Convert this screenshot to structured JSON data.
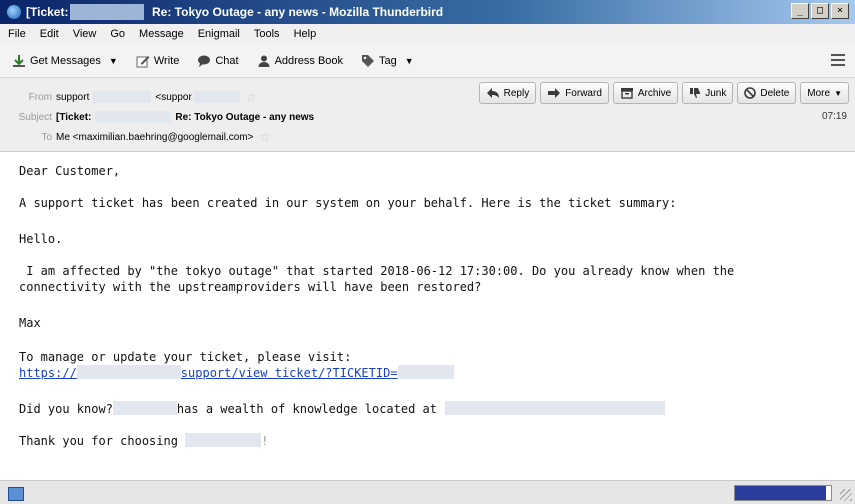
{
  "window": {
    "title_prefix": "[Ticket:",
    "title_suffix": "Re: Tokyo Outage - any news - Mozilla Thunderbird",
    "controls": [
      "_",
      "□",
      "×"
    ]
  },
  "menu": [
    "File",
    "Edit",
    "View",
    "Go",
    "Message",
    "Enigmail",
    "Tools",
    "Help"
  ],
  "toolbar": {
    "get_messages": "Get Messages",
    "write": "Write",
    "chat": "Chat",
    "address_book": "Address Book",
    "tag": "Tag"
  },
  "header": {
    "from_label": "From",
    "from_name": "support",
    "from_addr": "<suppor",
    "subject_label": "Subject",
    "subject_prefix": "[Ticket:",
    "subject_text": "Re: Tokyo Outage - any news",
    "to_label": "To",
    "to_value": "Me <maximilian.baehring@googlemail.com>",
    "time": "07:19",
    "actions": {
      "reply": "Reply",
      "forward": "Forward",
      "archive": "Archive",
      "junk": "Junk",
      "delete": "Delete",
      "more": "More"
    }
  },
  "body": {
    "greeting": "Dear Customer,",
    "intro": "A support ticket has been created in our system on your behalf. Here is the ticket summary:",
    "hello": "Hello.",
    "question_line1": " I am affected by \"the tokyo outage\" that started 2018-06-12 17:30:00. Do you already know when the",
    "question_line2": "connectivity with the upstreamproviders will have been restored?",
    "signature": "Max",
    "manage": "To manage or update your ticket, please visit:",
    "link_start": "https://",
    "link_mid": "support/view ticket/?TICKETID=",
    "didyouknow_a": "Did you know?",
    "didyouknow_b": "has a wealth of knowledge located at",
    "thanks": "Thank you for choosing",
    "thanks_end": "!"
  },
  "status": {
    "progress_fraction": 0.95
  },
  "colors": {
    "titlebar": "#0a246a",
    "link": "#1a3fbf",
    "progress": "#2b3d9a"
  }
}
